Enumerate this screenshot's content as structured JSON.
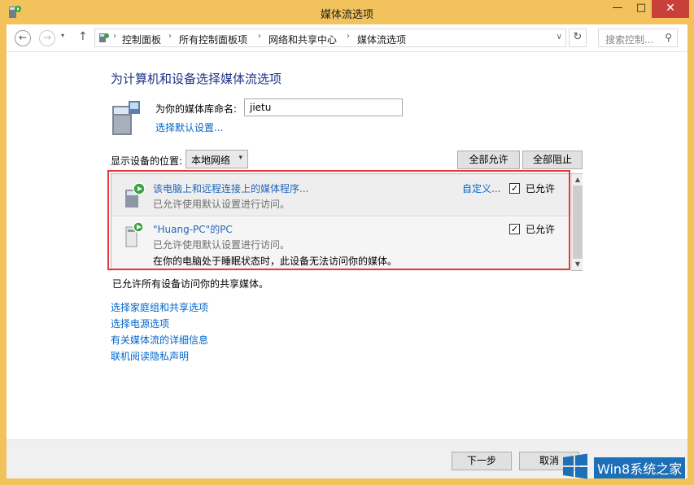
{
  "window": {
    "title": "媒体流选项"
  },
  "titlebar": {
    "minimize": "—",
    "maximize": "□",
    "close": "✕"
  },
  "nav": {
    "back": "←",
    "forward": "→",
    "dropdown": "▾",
    "up": "↑",
    "breadcrumb": [
      "控制面板",
      "所有控制面板项",
      "网络和共享中心",
      "媒体流选项"
    ],
    "separator": "›",
    "address_dropdown": "∨",
    "refresh": "↻",
    "search_placeholder": "搜索控制...",
    "search_glyph": "⚲"
  },
  "main": {
    "heading": "为计算机和设备选择媒体流选项",
    "library_label": "为你的媒体库命名:",
    "library_value": "jietu",
    "default_settings_link": "选择默认设置...",
    "location_label": "显示设备的位置:",
    "location_value": "本地网络",
    "location_dropdown": "▾",
    "allow_all": "全部允许",
    "block_all": "全部阻止"
  },
  "devices": [
    {
      "title": "该电脑上和远程连接上的媒体程序...",
      "subtitle": "已允许使用默认设置进行访问。",
      "customize": "自定义...",
      "allowed": true,
      "allowed_label": "已允许"
    },
    {
      "title": "\"Huang-PC\"的PC",
      "subtitle": "已允许使用默认设置进行访问。",
      "warning": "在你的电脑处于睡眠状态时，此设备无法访问你的媒体。",
      "allowed": true,
      "allowed_label": "已允许"
    }
  ],
  "check_glyph": "✓",
  "scrollbar": {
    "up": "▲",
    "down": "▼"
  },
  "status": "已允许所有设备访问你的共享媒体。",
  "links": [
    "选择家庭组和共享选项",
    "选择电源选项",
    "有关媒体流的详细信息",
    "联机阅读隐私声明"
  ],
  "footer": {
    "next": "下一步",
    "cancel": "取消"
  },
  "watermark": {
    "text": "Win8系统之家"
  },
  "colors": {
    "accent": "#f2c35c",
    "link": "#0066cc",
    "heading": "#1e3287",
    "highlight": "#e8393f",
    "close": "#c7413a"
  }
}
